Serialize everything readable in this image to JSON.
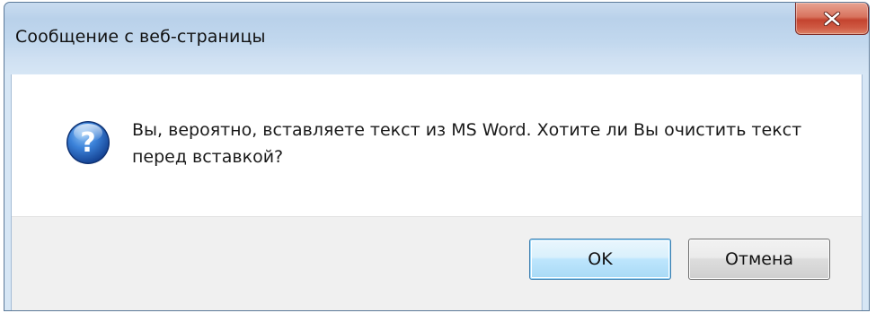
{
  "dialog": {
    "title": "Сообщение с веб-страницы",
    "message": "Вы, вероятно, вставляете текст из MS Word. Хотите ли Вы очистить текст перед вставкой?",
    "icon": "question-icon",
    "buttons": {
      "ok_label": "OK",
      "cancel_label": "Отмена"
    }
  },
  "colors": {
    "close_button": "#c4442f",
    "ok_button_border": "#3c7fb1",
    "question_icon": "#1e5db3"
  }
}
